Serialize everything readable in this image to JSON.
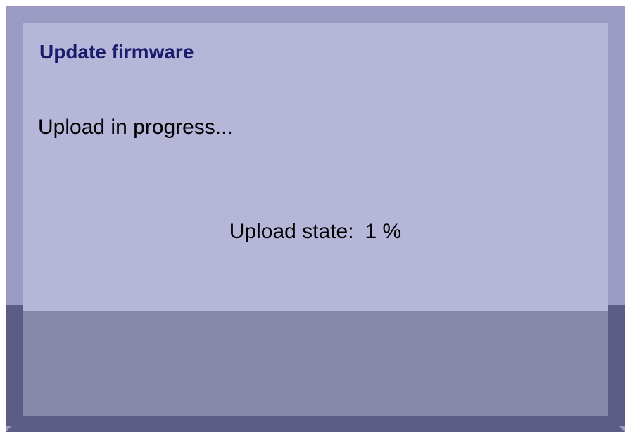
{
  "dialog": {
    "title": "Update firmware",
    "status_message": "Upload in progress...",
    "upload_state_label": "Upload state:",
    "upload_state_value": "1 %",
    "upload_progress_percent": 1
  },
  "colors": {
    "title_text": "#1c1c6e",
    "frame_border": "#9a9ac2",
    "frame_border_dark": "#5c5c86",
    "content_background": "#b6b6d8",
    "footer_background": "#8888a8"
  }
}
